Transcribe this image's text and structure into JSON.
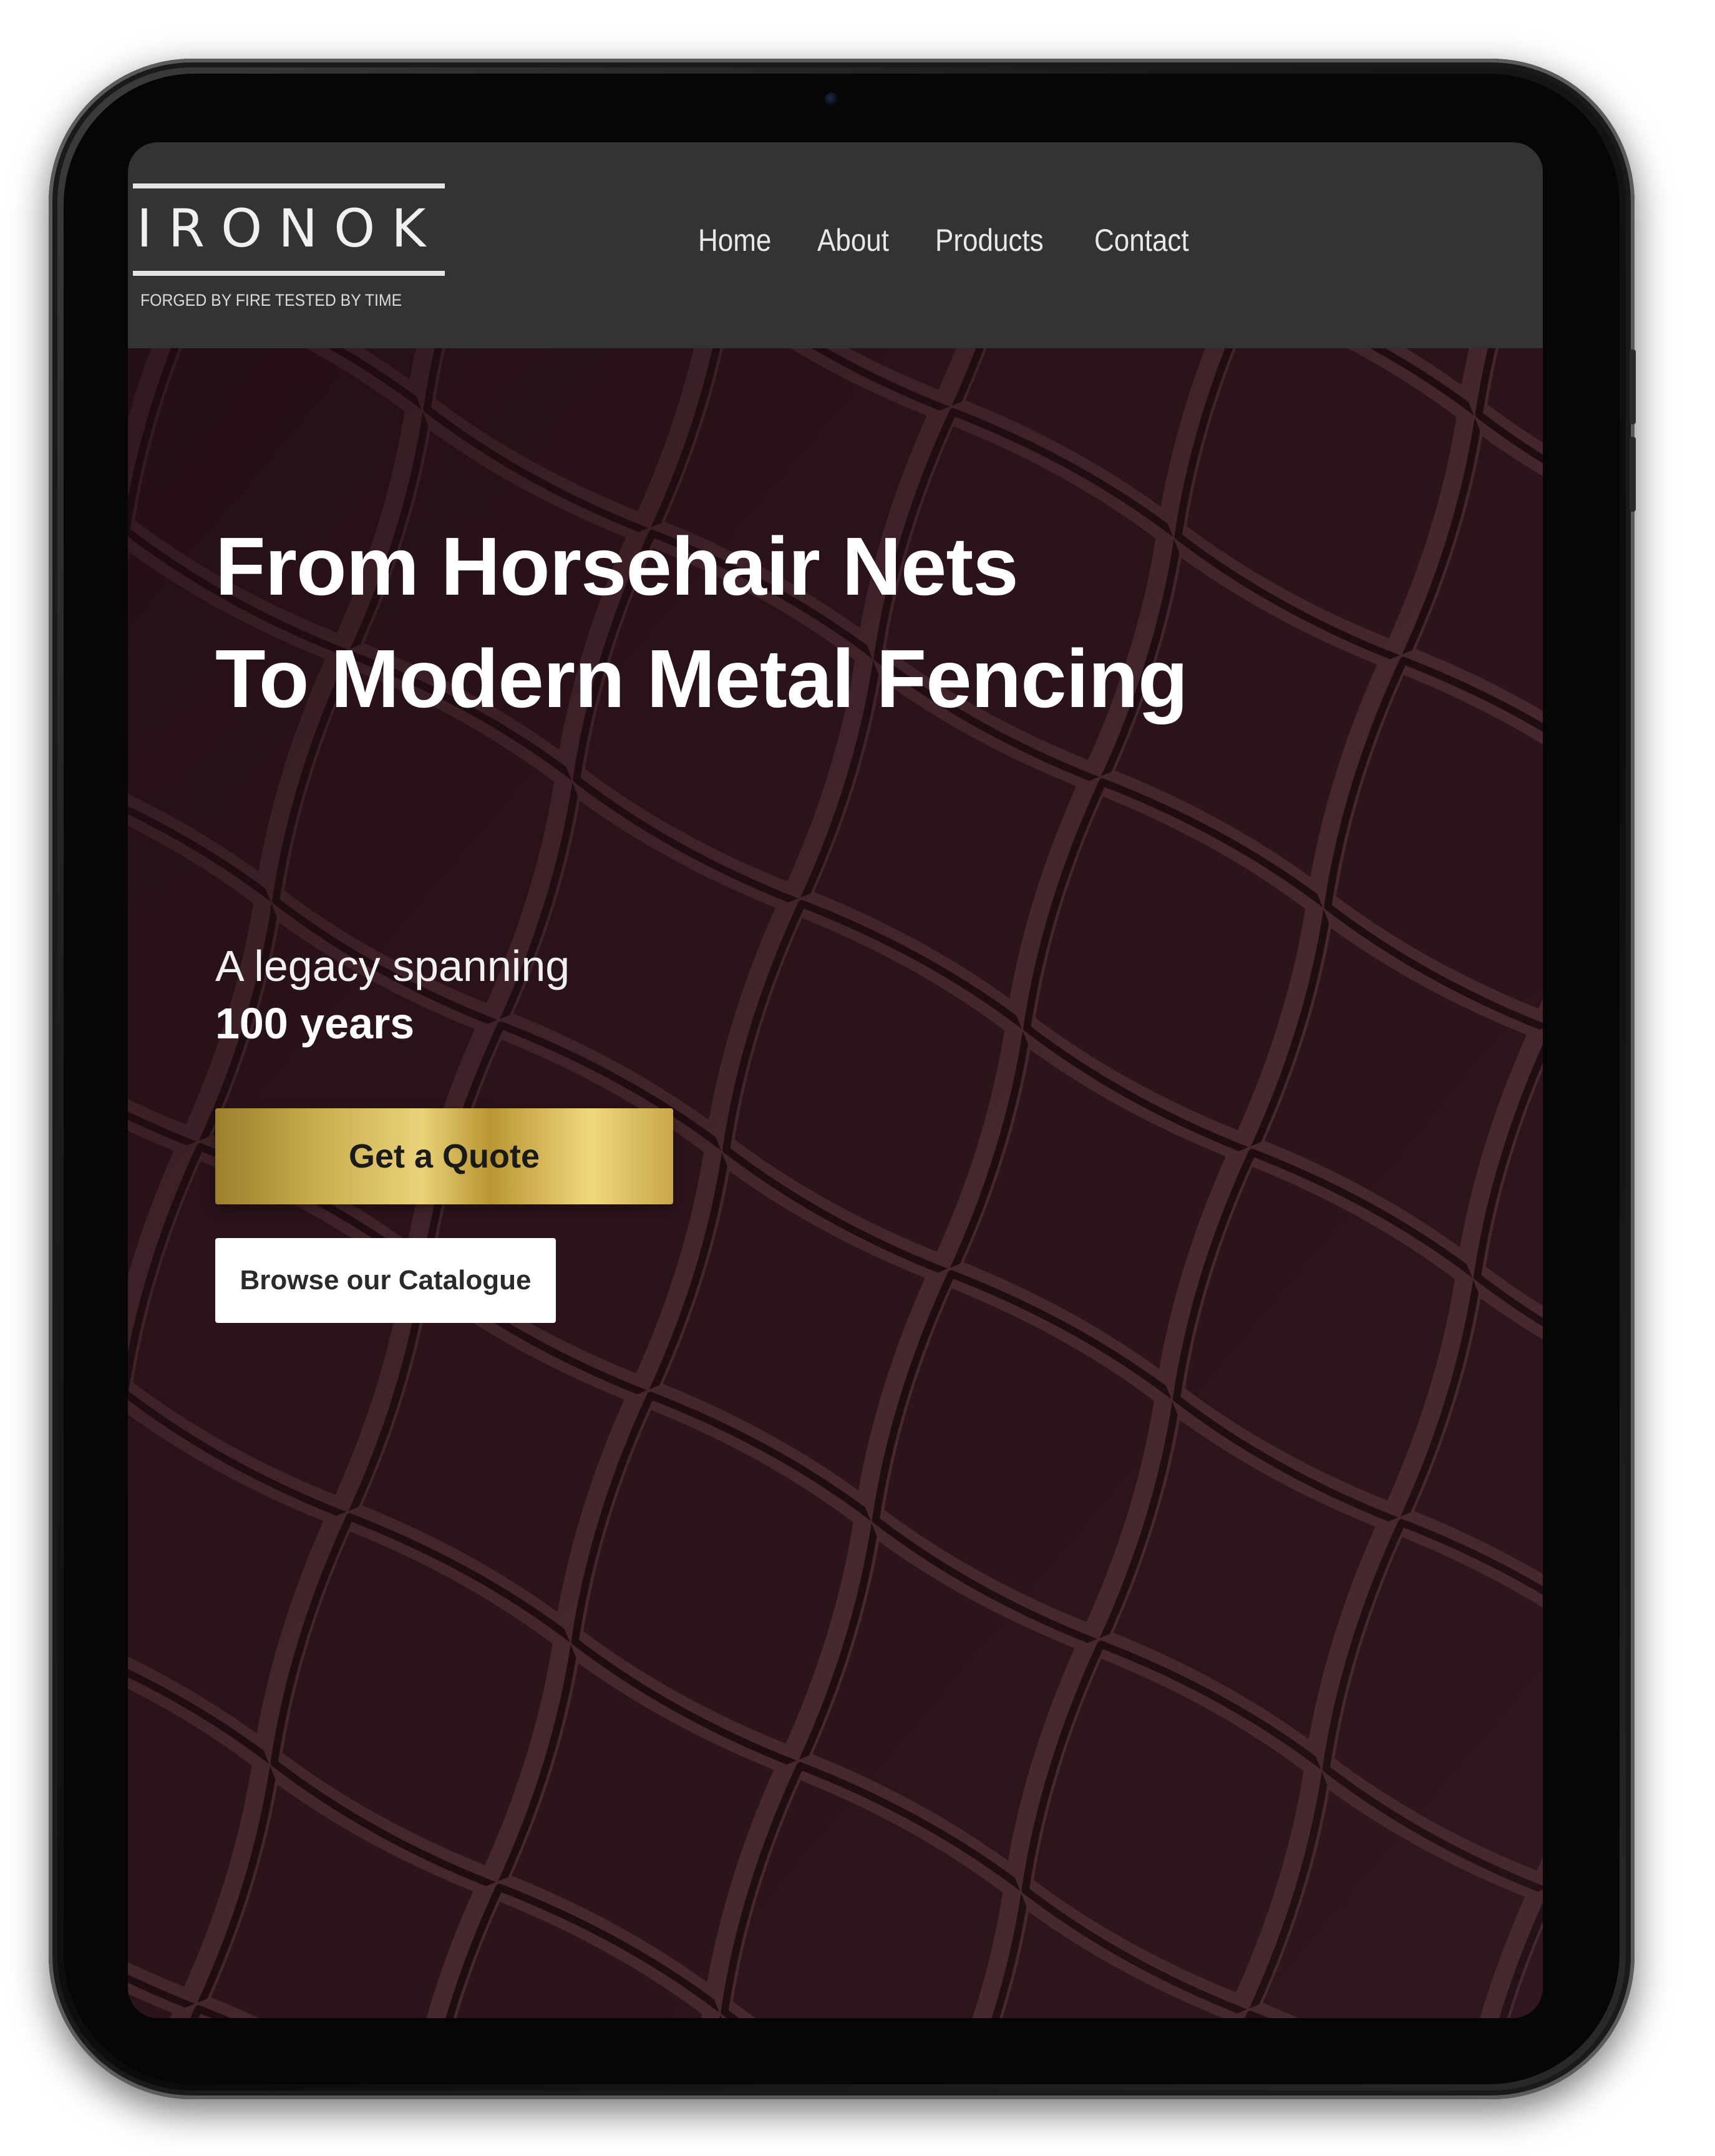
{
  "brand": {
    "name": "IRONOK",
    "tagline": "FORGED BY FIRE TESTED BY TIME"
  },
  "nav": {
    "items": [
      {
        "label": "Home"
      },
      {
        "label": "About"
      },
      {
        "label": "Products"
      },
      {
        "label": "Contact"
      }
    ]
  },
  "hero": {
    "title_line1": "From Horsehair Nets",
    "title_line2": "To Modern Metal Fencing",
    "subtitle": "A legacy spanning",
    "subtitle_bold": "100 years",
    "primary_cta": "Get a Quote",
    "secondary_cta": "Browse our Catalogue"
  },
  "floating": {
    "chat_icon": "whatsapp-icon"
  },
  "colors": {
    "header_bg": "#333333",
    "hero_bg": "#2b141a",
    "gold": "#d4b65a",
    "whatsapp_green": "#3dba54"
  }
}
